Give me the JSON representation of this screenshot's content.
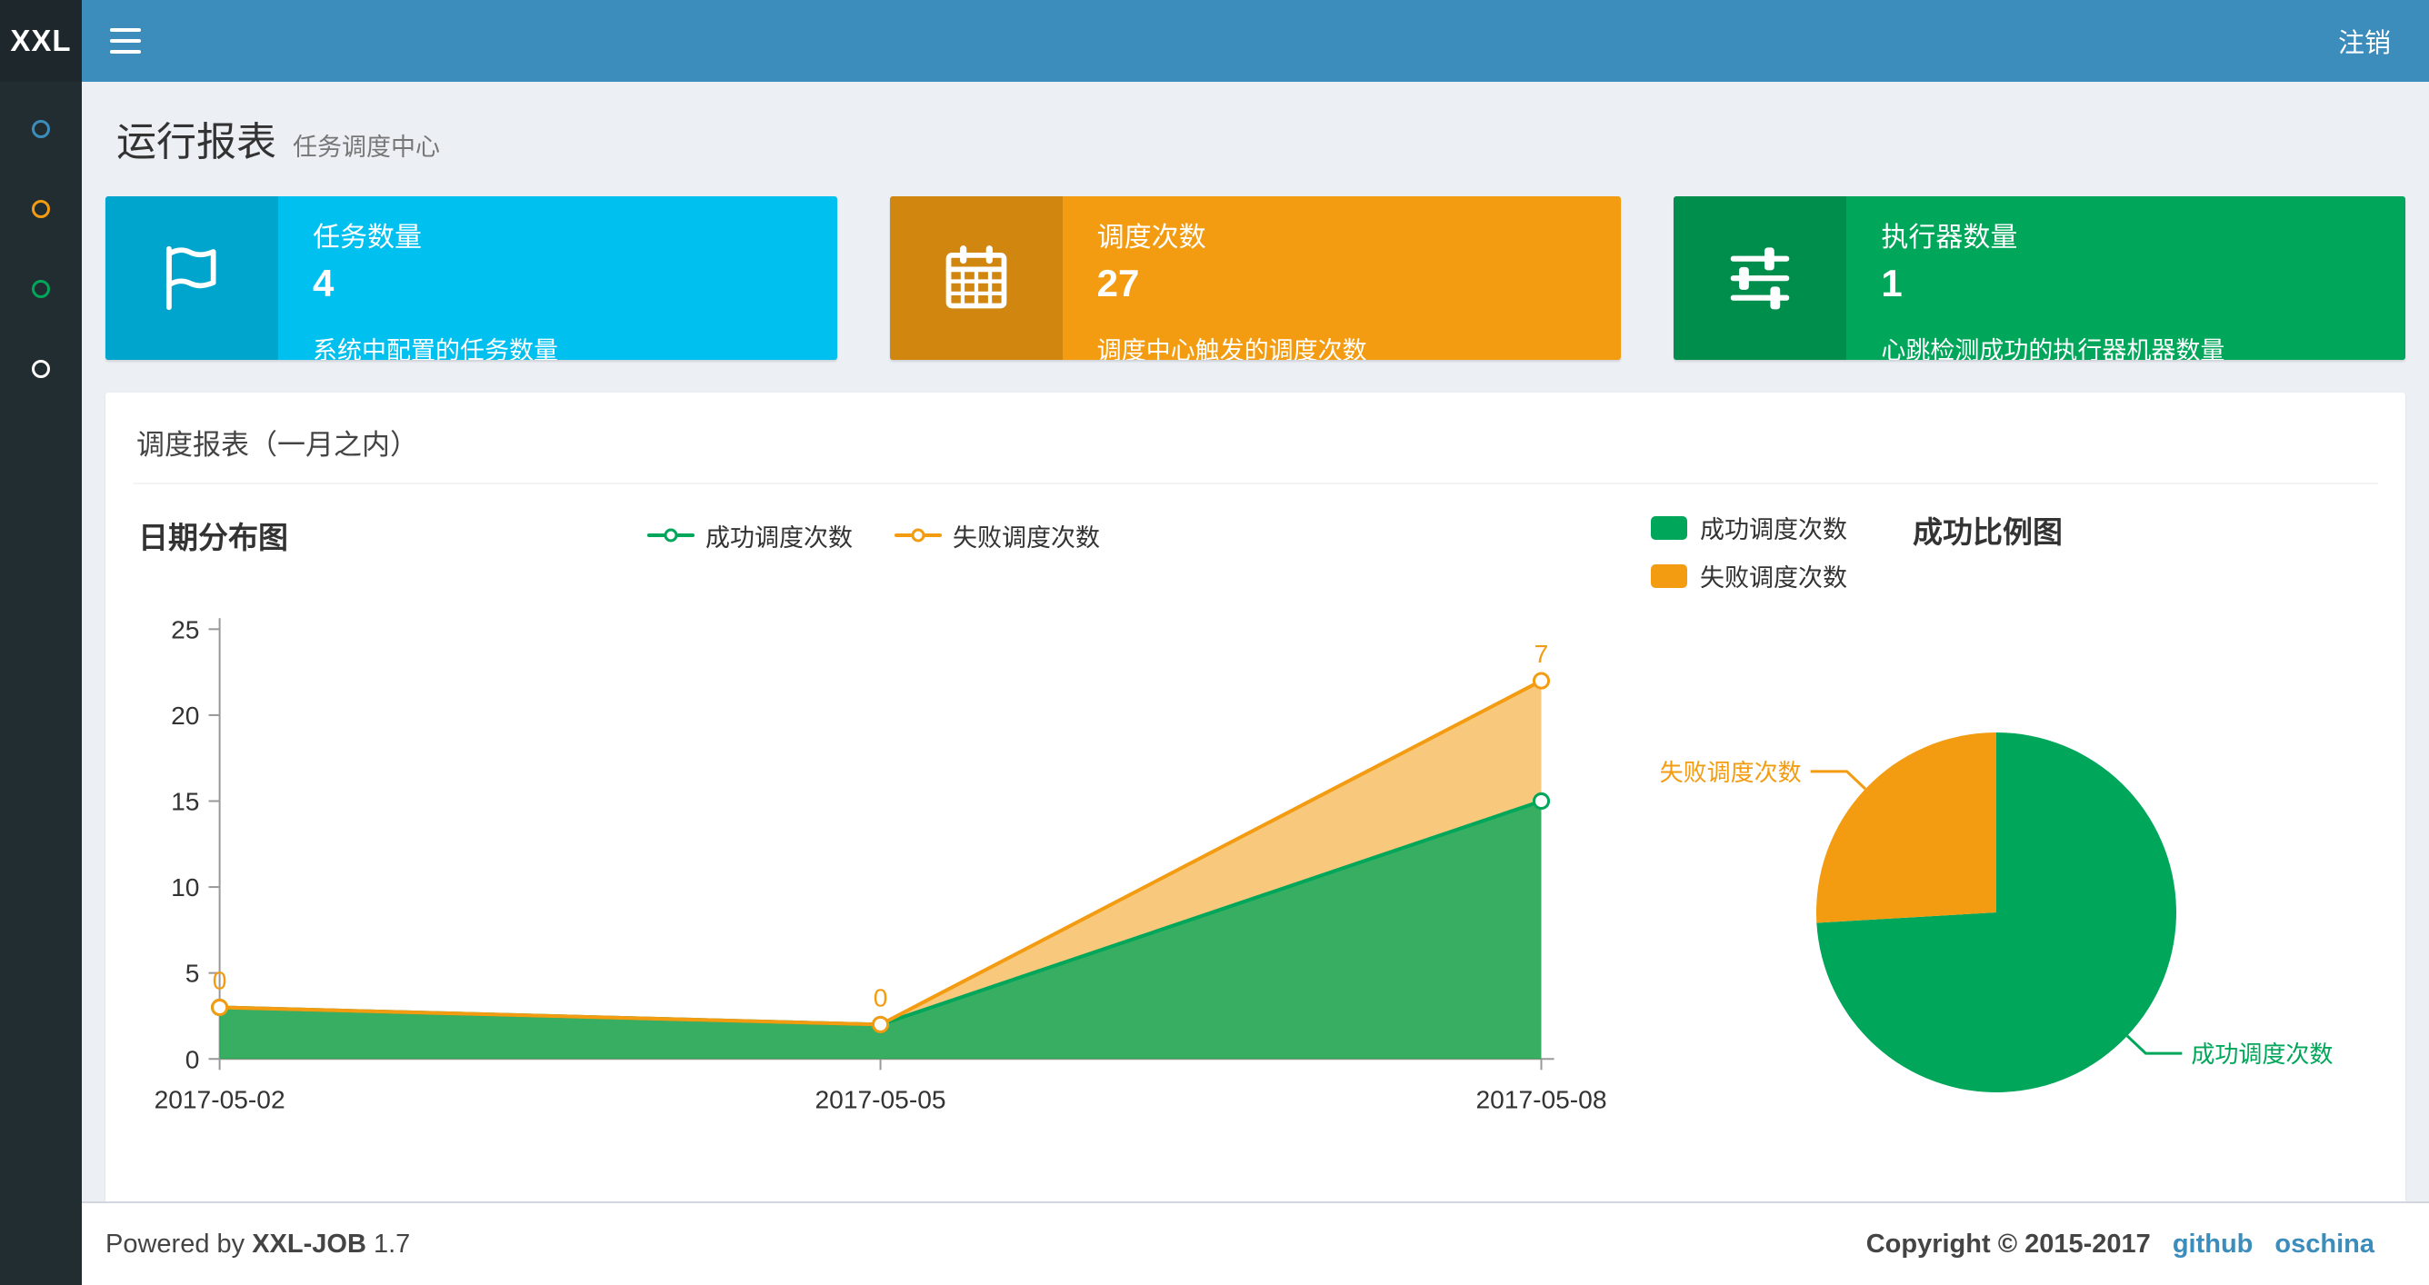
{
  "navbar": {
    "logo": "XXL",
    "logout": "注销"
  },
  "sidebar": {
    "items": [
      {
        "icon": "circle-icon",
        "color": "#3c8dbc"
      },
      {
        "icon": "circle-icon",
        "color": "#f39c12"
      },
      {
        "icon": "circle-icon",
        "color": "#00a65a"
      },
      {
        "icon": "circle-icon",
        "color": "#ffffff"
      }
    ]
  },
  "page_header": {
    "title": "运行报表",
    "subtitle": "任务调度中心"
  },
  "info_boxes": [
    {
      "icon": "flag-icon",
      "title": "任务数量",
      "value": "4",
      "desc": "系统中配置的任务数量",
      "color": "#00c0ef"
    },
    {
      "icon": "calendar-icon",
      "title": "调度次数",
      "value": "27",
      "desc": "调度中心触发的调度次数",
      "color": "#f39c12"
    },
    {
      "icon": "sliders-icon",
      "title": "执行器数量",
      "value": "1",
      "desc": "心跳检测成功的执行器机器数量",
      "color": "#00a65a"
    }
  ],
  "report_panel": {
    "title": "调度报表（一月之内）"
  },
  "chart_data": [
    {
      "type": "area",
      "title": "日期分布图",
      "x": [
        "2017-05-02",
        "2017-05-05",
        "2017-05-08"
      ],
      "series": [
        {
          "name": "成功调度次数",
          "values": [
            3,
            2,
            15
          ],
          "color": "#00a65a"
        },
        {
          "name": "失败调度次数",
          "values": [
            0,
            0,
            7
          ],
          "color": "#f39c12",
          "data_labels": [
            "0",
            "0",
            "7"
          ]
        }
      ],
      "stacked": true,
      "ylim": [
        0,
        25
      ],
      "yticks": [
        0,
        5,
        10,
        15,
        20,
        25
      ],
      "grid": false,
      "legend_position": "top-center"
    },
    {
      "type": "pie",
      "title": "成功比例图",
      "slices": [
        {
          "name": "成功调度次数",
          "value": 20,
          "color": "#00a65a"
        },
        {
          "name": "失败调度次数",
          "value": 7,
          "color": "#f39c12"
        }
      ],
      "legend_position": "top-left"
    }
  ],
  "footer": {
    "powered": "Powered by",
    "product": "XXL-JOB",
    "version": "1.7",
    "copyright": "Copyright © 2015-2017",
    "links": [
      {
        "label": "github"
      },
      {
        "label": "oschina"
      }
    ]
  }
}
